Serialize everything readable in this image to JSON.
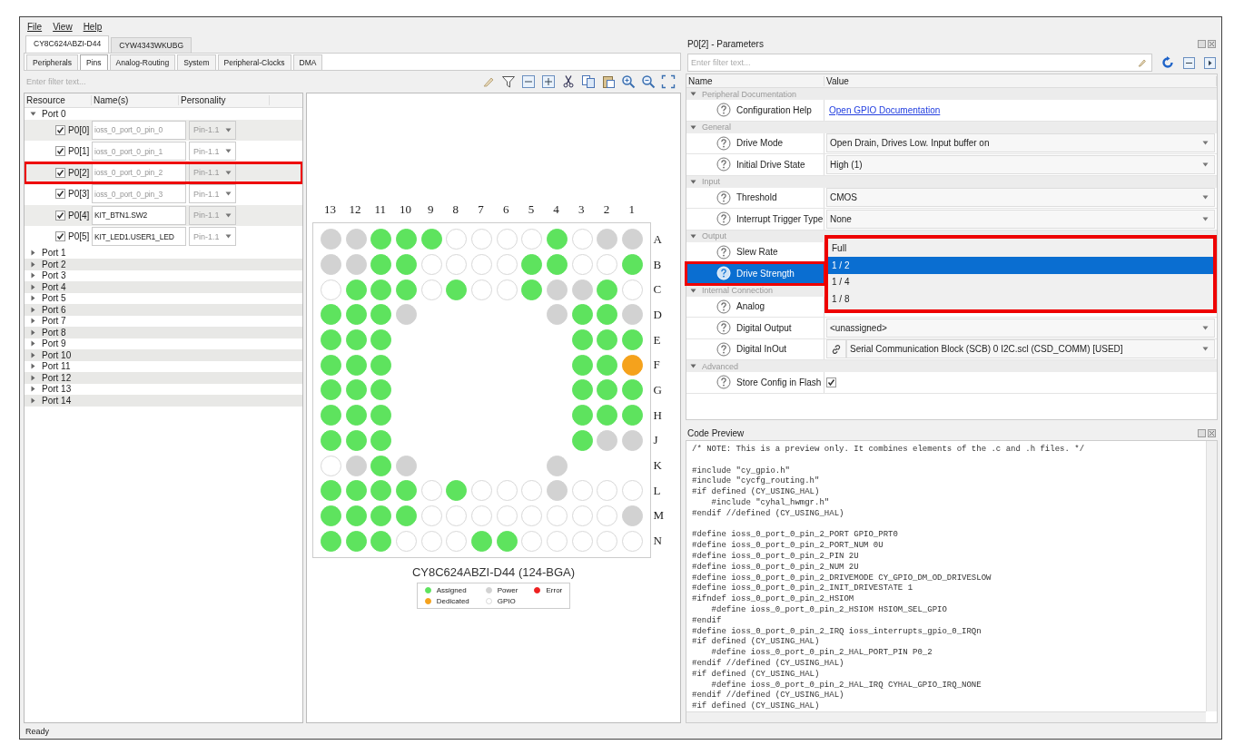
{
  "menu": [
    "File",
    "View",
    "Help"
  ],
  "device_tabs": [
    {
      "label": "CY8C624ABZI-D44",
      "selected": true
    },
    {
      "label": "CYW4343WKUBG",
      "selected": false
    }
  ],
  "sub_tabs": [
    {
      "label": "Peripherals",
      "selected": false
    },
    {
      "label": "Pins",
      "selected": true
    },
    {
      "label": "Analog-Routing",
      "selected": false
    },
    {
      "label": "System",
      "selected": false
    },
    {
      "label": "Peripheral-Clocks",
      "selected": false
    },
    {
      "label": "DMA",
      "selected": false
    }
  ],
  "filter": {
    "placeholder": "Enter filter text..."
  },
  "pin_tree": {
    "columns": [
      "Resource",
      "Name(s)",
      "Personality"
    ],
    "ports": [
      {
        "label": "Port 0",
        "expanded": true,
        "children": [
          {
            "label": "P0[0]",
            "checked": true,
            "name": "ioss_0_port_0_pin_0",
            "default_name": true,
            "personality": "Pin-1.1",
            "highlighted": false
          },
          {
            "label": "P0[1]",
            "checked": true,
            "name": "ioss_0_port_0_pin_1",
            "default_name": true,
            "personality": "Pin-1.1",
            "highlighted": false
          },
          {
            "label": "P0[2]",
            "checked": true,
            "name": "ioss_0_port_0_pin_2",
            "default_name": true,
            "personality": "Pin-1.1",
            "highlighted": true
          },
          {
            "label": "P0[3]",
            "checked": true,
            "name": "ioss_0_port_0_pin_3",
            "default_name": true,
            "personality": "Pin-1.1",
            "highlighted": false
          },
          {
            "label": "P0[4]",
            "checked": true,
            "name": "KIT_BTN1.SW2",
            "default_name": false,
            "personality": "Pin-1.1",
            "highlighted": false
          },
          {
            "label": "P0[5]",
            "checked": true,
            "name": "KIT_LED1.USER1_LED",
            "default_name": false,
            "personality": "Pin-1.1",
            "highlighted": false
          }
        ]
      },
      {
        "label": "Port 1",
        "expanded": false
      },
      {
        "label": "Port 2",
        "expanded": false
      },
      {
        "label": "Port 3",
        "expanded": false
      },
      {
        "label": "Port 4",
        "expanded": false
      },
      {
        "label": "Port 5",
        "expanded": false
      },
      {
        "label": "Port 6",
        "expanded": false
      },
      {
        "label": "Port 7",
        "expanded": false
      },
      {
        "label": "Port 8",
        "expanded": false
      },
      {
        "label": "Port 9",
        "expanded": false
      },
      {
        "label": "Port 10",
        "expanded": false
      },
      {
        "label": "Port 11",
        "expanded": false
      },
      {
        "label": "Port 12",
        "expanded": false
      },
      {
        "label": "Port 13",
        "expanded": false
      },
      {
        "label": "Port 14",
        "expanded": false
      }
    ]
  },
  "chip": {
    "column_labels": [
      "13",
      "12",
      "11",
      "10",
      "9",
      "8",
      "7",
      "6",
      "5",
      "4",
      "3",
      "2",
      "1"
    ],
    "rows": [
      {
        "label": "A",
        "pins": [
          {
            "kind": "power"
          },
          {
            "kind": "power"
          },
          {
            "kind": "assigned"
          },
          {
            "kind": "assigned"
          },
          {
            "kind": "assigned"
          },
          {
            "kind": "gpio"
          },
          {
            "kind": "gpio"
          },
          {
            "kind": "gpio"
          },
          {
            "kind": "gpio"
          },
          {
            "kind": "assigned"
          },
          {
            "kind": "gpio"
          },
          {
            "kind": "power"
          },
          {
            "kind": "power"
          }
        ]
      },
      {
        "label": "B",
        "pins": [
          {
            "kind": "power"
          },
          {
            "kind": "power"
          },
          {
            "kind": "assigned"
          },
          {
            "kind": "assigned"
          },
          {
            "kind": "gpio"
          },
          {
            "kind": "gpio"
          },
          {
            "kind": "gpio"
          },
          {
            "kind": "gpio"
          },
          {
            "kind": "assigned"
          },
          {
            "kind": "assigned"
          },
          {
            "kind": "gpio"
          },
          {
            "kind": "gpio"
          },
          {
            "kind": "assigned"
          }
        ]
      },
      {
        "label": "C",
        "pins": [
          {
            "kind": "gpio"
          },
          {
            "kind": "assigned"
          },
          {
            "kind": "assigned"
          },
          {
            "kind": "assigned"
          },
          {
            "kind": "gpio"
          },
          {
            "kind": "assigned"
          },
          {
            "kind": "gpio"
          },
          {
            "kind": "gpio"
          },
          {
            "kind": "assigned"
          },
          {
            "kind": "power"
          },
          {
            "kind": "power"
          },
          {
            "kind": "assigned"
          },
          {
            "kind": "gpio"
          }
        ]
      },
      {
        "label": "D",
        "pins": [
          {
            "kind": "assigned"
          },
          {
            "kind": "assigned"
          },
          {
            "kind": "assigned"
          },
          {
            "kind": "power"
          },
          {
            "kind": "empty"
          },
          {
            "kind": "empty"
          },
          {
            "kind": "empty"
          },
          {
            "kind": "empty"
          },
          {
            "kind": "empty"
          },
          {
            "kind": "power"
          },
          {
            "kind": "assigned"
          },
          {
            "kind": "assigned"
          },
          {
            "kind": "power"
          }
        ]
      },
      {
        "label": "E",
        "pins": [
          {
            "kind": "assigned"
          },
          {
            "kind": "assigned"
          },
          {
            "kind": "assigned"
          },
          {
            "kind": "empty"
          },
          {
            "kind": "empty"
          },
          {
            "kind": "empty"
          },
          {
            "kind": "empty"
          },
          {
            "kind": "empty"
          },
          {
            "kind": "empty"
          },
          {
            "kind": "empty"
          },
          {
            "kind": "assigned"
          },
          {
            "kind": "assigned"
          },
          {
            "kind": "assigned"
          }
        ]
      },
      {
        "label": "F",
        "pins": [
          {
            "kind": "assigned"
          },
          {
            "kind": "assigned"
          },
          {
            "kind": "assigned"
          },
          {
            "kind": "empty"
          },
          {
            "kind": "empty"
          },
          {
            "kind": "empty"
          },
          {
            "kind": "empty"
          },
          {
            "kind": "empty"
          },
          {
            "kind": "empty"
          },
          {
            "kind": "empty"
          },
          {
            "kind": "assigned"
          },
          {
            "kind": "assigned"
          },
          {
            "kind": "dedicated"
          }
        ]
      },
      {
        "label": "G",
        "pins": [
          {
            "kind": "assigned"
          },
          {
            "kind": "assigned"
          },
          {
            "kind": "assigned"
          },
          {
            "kind": "empty"
          },
          {
            "kind": "empty"
          },
          {
            "kind": "empty"
          },
          {
            "kind": "empty"
          },
          {
            "kind": "empty"
          },
          {
            "kind": "empty"
          },
          {
            "kind": "empty"
          },
          {
            "kind": "assigned"
          },
          {
            "kind": "assigned"
          },
          {
            "kind": "assigned"
          }
        ]
      },
      {
        "label": "H",
        "pins": [
          {
            "kind": "assigned"
          },
          {
            "kind": "assigned"
          },
          {
            "kind": "assigned"
          },
          {
            "kind": "empty"
          },
          {
            "kind": "empty"
          },
          {
            "kind": "empty"
          },
          {
            "kind": "empty"
          },
          {
            "kind": "empty"
          },
          {
            "kind": "empty"
          },
          {
            "kind": "empty"
          },
          {
            "kind": "assigned"
          },
          {
            "kind": "assigned"
          },
          {
            "kind": "assigned"
          }
        ]
      },
      {
        "label": "J",
        "pins": [
          {
            "kind": "assigned"
          },
          {
            "kind": "assigned"
          },
          {
            "kind": "assigned"
          },
          {
            "kind": "empty"
          },
          {
            "kind": "empty"
          },
          {
            "kind": "empty"
          },
          {
            "kind": "empty"
          },
          {
            "kind": "empty"
          },
          {
            "kind": "empty"
          },
          {
            "kind": "empty"
          },
          {
            "kind": "assigned"
          },
          {
            "kind": "power"
          },
          {
            "kind": "power"
          }
        ]
      },
      {
        "label": "K",
        "pins": [
          {
            "kind": "gpio"
          },
          {
            "kind": "power"
          },
          {
            "kind": "assigned"
          },
          {
            "kind": "power"
          },
          {
            "kind": "empty"
          },
          {
            "kind": "empty"
          },
          {
            "kind": "empty"
          },
          {
            "kind": "empty"
          },
          {
            "kind": "empty"
          },
          {
            "kind": "power"
          },
          {
            "kind": "empty"
          },
          {
            "kind": "empty"
          },
          {
            "kind": "empty"
          }
        ]
      },
      {
        "label": "L",
        "pins": [
          {
            "kind": "assigned"
          },
          {
            "kind": "assigned"
          },
          {
            "kind": "assigned"
          },
          {
            "kind": "assigned"
          },
          {
            "kind": "gpio"
          },
          {
            "kind": "assigned"
          },
          {
            "kind": "gpio"
          },
          {
            "kind": "gpio"
          },
          {
            "kind": "gpio"
          },
          {
            "kind": "power"
          },
          {
            "kind": "gpio"
          },
          {
            "kind": "gpio"
          },
          {
            "kind": "gpio"
          }
        ]
      },
      {
        "label": "M",
        "pins": [
          {
            "kind": "assigned"
          },
          {
            "kind": "assigned"
          },
          {
            "kind": "assigned"
          },
          {
            "kind": "assigned"
          },
          {
            "kind": "gpio"
          },
          {
            "kind": "gpio"
          },
          {
            "kind": "gpio"
          },
          {
            "kind": "gpio"
          },
          {
            "kind": "gpio"
          },
          {
            "kind": "gpio"
          },
          {
            "kind": "gpio"
          },
          {
            "kind": "gpio"
          },
          {
            "kind": "power"
          }
        ]
      },
      {
        "label": "N",
        "pins": [
          {
            "kind": "assigned"
          },
          {
            "kind": "assigned"
          },
          {
            "kind": "assigned"
          },
          {
            "kind": "gpio"
          },
          {
            "kind": "gpio"
          },
          {
            "kind": "gpio"
          },
          {
            "kind": "assigned"
          },
          {
            "kind": "assigned"
          },
          {
            "kind": "gpio"
          },
          {
            "kind": "gpio"
          },
          {
            "kind": "gpio"
          },
          {
            "kind": "gpio"
          },
          {
            "kind": "gpio"
          }
        ]
      }
    ],
    "title": "CY8C624ABZI-D44 (124-BGA)",
    "legend": [
      {
        "label": "Assigned",
        "kind": "assigned"
      },
      {
        "label": "Power",
        "kind": "power"
      },
      {
        "label": "Error",
        "kind": "error"
      },
      {
        "label": "Dedicated",
        "kind": "dedicated"
      },
      {
        "label": "GPIO",
        "kind": "gpio"
      }
    ]
  },
  "parameters": {
    "title": "P0[2] - Parameters",
    "filter": {
      "placeholder": "Enter filter text..."
    },
    "columns": [
      "Name",
      "Value"
    ],
    "groups": [
      {
        "label": "Peripheral Documentation",
        "expanded": true,
        "children": [
          {
            "name": "Configuration Help",
            "kind": "link",
            "value": "Open GPIO Documentation",
            "selected": false,
            "highlighted": false
          }
        ]
      },
      {
        "label": "General",
        "expanded": true,
        "children": [
          {
            "name": "Drive Mode",
            "kind": "dropdown",
            "value": "Open Drain, Drives Low. Input buffer on",
            "selected": false,
            "highlighted": false
          },
          {
            "name": "Initial Drive State",
            "kind": "dropdown",
            "value": "High (1)",
            "selected": false,
            "highlighted": false
          }
        ]
      },
      {
        "label": "Input",
        "expanded": true,
        "children": [
          {
            "name": "Threshold",
            "kind": "dropdown",
            "value": "CMOS",
            "selected": false,
            "highlighted": false
          },
          {
            "name": "Interrupt Trigger Type",
            "kind": "dropdown",
            "value": "None",
            "selected": false,
            "highlighted": false
          }
        ]
      },
      {
        "label": "Output",
        "expanded": true,
        "children": [
          {
            "name": "Slew Rate",
            "kind": "covered",
            "selected": false,
            "highlighted": false
          },
          {
            "name": "Drive Strength",
            "kind": "covered",
            "selected": true,
            "highlighted": true
          }
        ]
      },
      {
        "label": "Internal Connection",
        "expanded": true,
        "children": [
          {
            "name": "Analog",
            "kind": "covered",
            "selected": false,
            "highlighted": false
          },
          {
            "name": "Digital Output",
            "kind": "dropdown",
            "value": "<unassigned>",
            "selected": false,
            "highlighted": false
          },
          {
            "name": "Digital InOut",
            "kind": "linked-dropdown",
            "value": "Serial Communication Block (SCB) 0 I2C.scl (CSD_COMM) [USED]",
            "selected": false,
            "highlighted": false
          }
        ]
      },
      {
        "label": "Advanced",
        "expanded": true,
        "children": [
          {
            "name": "Store Config in Flash",
            "kind": "checkbox",
            "checked": true,
            "selected": false,
            "highlighted": false
          }
        ]
      }
    ],
    "dropdown": {
      "highlighted": true,
      "options": [
        {
          "label": "Full",
          "selected": false
        },
        {
          "label": "1 / 2",
          "selected": true
        },
        {
          "label": "1 / 4",
          "selected": false
        },
        {
          "label": "1 / 8",
          "selected": false
        }
      ]
    }
  },
  "code_preview": {
    "title": "Code Preview",
    "code": "/* NOTE: This is a preview only. It combines elements of the .c and .h files. */\n\n#include \"cy_gpio.h\"\n#include \"cycfg_routing.h\"\n#if defined (CY_USING_HAL)\n    #include \"cyhal_hwmgr.h\"\n#endif //defined (CY_USING_HAL)\n\n#define ioss_0_port_0_pin_2_PORT GPIO_PRT0\n#define ioss_0_port_0_pin_2_PORT_NUM 0U\n#define ioss_0_port_0_pin_2_PIN 2U\n#define ioss_0_port_0_pin_2_NUM 2U\n#define ioss_0_port_0_pin_2_DRIVEMODE CY_GPIO_DM_OD_DRIVESLOW\n#define ioss_0_port_0_pin_2_INIT_DRIVESTATE 1\n#ifndef ioss_0_port_0_pin_2_HSIOM\n    #define ioss_0_port_0_pin_2_HSIOM HSIOM_SEL_GPIO\n#endif\n#define ioss_0_port_0_pin_2_IRQ ioss_interrupts_gpio_0_IRQn\n#if defined (CY_USING_HAL)\n    #define ioss_0_port_0_pin_2_HAL_PORT_PIN P0_2\n#endif //defined (CY_USING_HAL)\n#if defined (CY_USING_HAL)\n    #define ioss_0_port_0_pin_2_HAL_IRQ CYHAL_GPIO_IRQ_NONE\n#endif //defined (CY_USING_HAL)\n#if defined (CY_USING_HAL)"
  },
  "status_bar": "Ready"
}
